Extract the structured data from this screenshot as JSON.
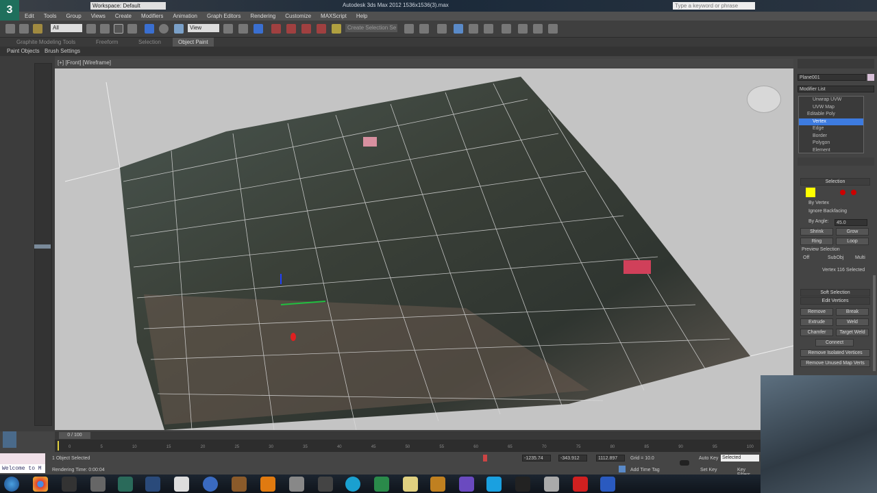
{
  "title_bar": {
    "app_title": "Autodesk 3ds Max 2012   1536x1536(3).max",
    "workspace": "Workspace: Default",
    "search_placeholder": "Type a keyword or phrase",
    "logo": "3"
  },
  "menu": [
    "Edit",
    "Tools",
    "Group",
    "Views",
    "Create",
    "Modifiers",
    "Animation",
    "Graph Editors",
    "Rendering",
    "Customize",
    "MAXScript",
    "Help"
  ],
  "toolbar": {
    "selection_filter": "All",
    "ref_coord": "View",
    "named_selection": "Create Selection Se"
  },
  "ribbon": {
    "tabs": [
      "Graphite Modeling Tools",
      "Freeform",
      "Selection",
      "Object Paint"
    ],
    "subtabs": [
      "Paint Objects",
      "Brush Settings"
    ]
  },
  "viewport": {
    "label": "[+] [Front] [Wireframe]"
  },
  "command_panel": {
    "object_name": "Plane001",
    "modifier_list": "Modifier List",
    "stack": [
      "Unwrap UVW",
      "UVW Map",
      "Editable Poly",
      "Vertex",
      "Edge",
      "Border",
      "Polygon",
      "Element"
    ],
    "selected_stack": "Vertex",
    "selection_title": "Selection",
    "by_vertex": "By Vertex",
    "ignore_backfacing": "Ignore Backfacing",
    "by_angle": "By Angle:",
    "angle_value": "45.0",
    "shrink": "Shrink",
    "grow": "Grow",
    "ring": "Ring",
    "loop": "Loop",
    "preview_selection": "Preview Selection",
    "preview_options": [
      "Off",
      "SubObj",
      "Multi"
    ],
    "vertices_selected": "Vertex 116 Selected",
    "soft_selection": "Soft Selection",
    "edit_vertices": "Edit Vertices",
    "remove": "Remove",
    "break": "Break",
    "extrude": "Extrude",
    "weld": "Weld",
    "chamfer": "Chamfer",
    "target_weld": "Target Weld",
    "connect": "Connect",
    "remove_isolated": "Remove Isolated Vertices",
    "remove_unused": "Remove Unused Map Verts"
  },
  "timeline": {
    "frame": "0 / 100",
    "ticks": [
      "0",
      "5",
      "10",
      "15",
      "20",
      "25",
      "30",
      "35",
      "40",
      "45",
      "50",
      "55",
      "60",
      "65",
      "70",
      "75",
      "80",
      "85",
      "90",
      "95",
      "100"
    ]
  },
  "status": {
    "selected": "1 Object Selected",
    "render_time": "Rendering Time: 0:00:04",
    "x": "-1235.74",
    "y": "-343.912",
    "z": "1112.897",
    "grid": "Grid = 10.0",
    "add_time_tag": "Add Time Tag",
    "auto_key": "Auto Key",
    "set_key": "Set Key",
    "key_filter": "Selected",
    "key_filters": "Key Filters...",
    "maxscript": "Welcome to M"
  }
}
